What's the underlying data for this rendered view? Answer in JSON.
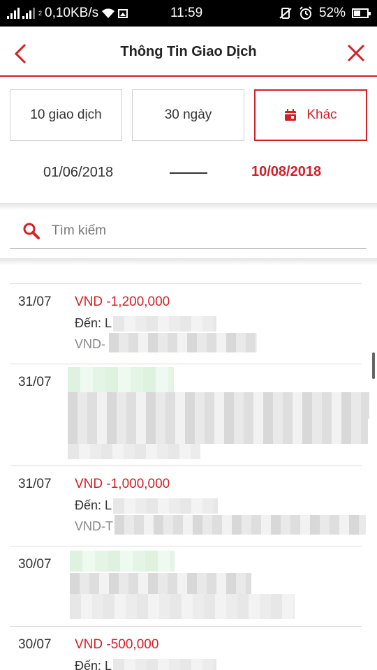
{
  "status_bar": {
    "net_speed": "0,10KB/s",
    "sim_label": "2",
    "time": "11:59",
    "battery": "52%",
    "icons": [
      "signal-icon",
      "signal-icon",
      "wifi-icon",
      "image-icon",
      "vibrate-off-icon",
      "alarm-icon",
      "battery-icon"
    ]
  },
  "header": {
    "title": "Thông Tin Giao Dịch",
    "back_icon": "chevron-left-icon",
    "close_icon": "close-icon"
  },
  "filters": {
    "btn_transactions": "10 giao dịch",
    "btn_days": "30 ngày",
    "btn_other": "Khác",
    "selected": "Khác"
  },
  "date_range": {
    "from": "01/06/2018",
    "to": "10/08/2018"
  },
  "search": {
    "placeholder": "Tìm kiếm"
  },
  "transactions": [
    {
      "date": "31/07",
      "amount": "VND -1,200,000",
      "to_prefix": "Đến: L",
      "acct_prefix": "VND-"
    },
    {
      "date": "31/07",
      "amount": "",
      "to_prefix": "",
      "acct_prefix": ""
    },
    {
      "date": "31/07",
      "amount": "VND -1,000,000",
      "to_prefix": "Đến: L",
      "acct_prefix": "VND-T"
    },
    {
      "date": "30/07",
      "amount": "",
      "to_prefix": "",
      "acct_prefix": ""
    },
    {
      "date": "30/07",
      "amount": "VND -500,000",
      "to_prefix": "Đến: L",
      "acct_prefix": ""
    }
  ],
  "colors": {
    "accent": "#d32027",
    "text": "#222222",
    "muted": "#888888",
    "border": "#cfcfcf"
  }
}
